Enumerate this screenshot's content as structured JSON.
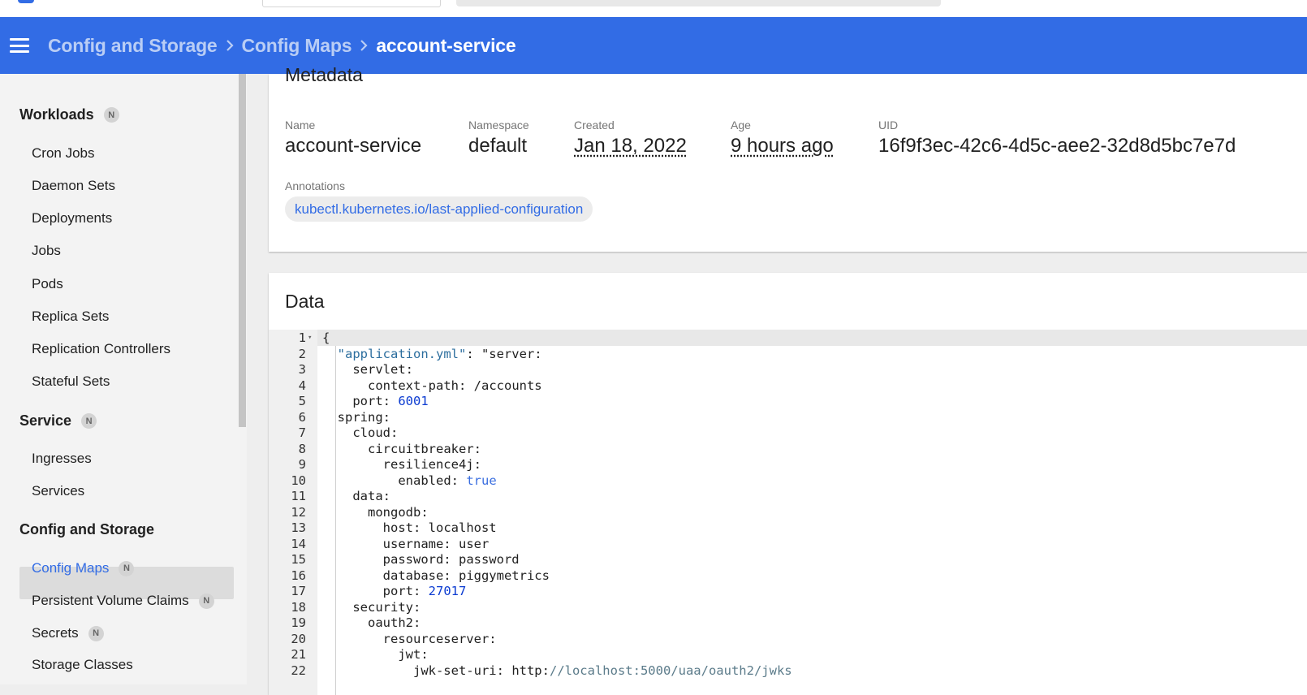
{
  "header": {
    "breadcrumbs": [
      "Config and Storage",
      "Config Maps",
      "account-service"
    ]
  },
  "sidebar": {
    "sections": [
      {
        "label": "Workloads",
        "badge": "N"
      },
      {
        "label": "Service",
        "badge": "N"
      },
      {
        "label": "Config and Storage"
      }
    ],
    "workloads_items": [
      "Cron Jobs",
      "Daemon Sets",
      "Deployments",
      "Jobs",
      "Pods",
      "Replica Sets",
      "Replication Controllers",
      "Stateful Sets"
    ],
    "service_items": [
      "Ingresses",
      "Services"
    ],
    "config_items": [
      {
        "label": "Config Maps",
        "badge": "N",
        "active": true
      },
      {
        "label": "Persistent Volume Claims",
        "badge": "N"
      },
      {
        "label": "Secrets",
        "badge": "N"
      },
      {
        "label": "Storage Classes"
      }
    ]
  },
  "metadata": {
    "title": "Metadata",
    "fields": {
      "name": {
        "label": "Name",
        "value": "account-service"
      },
      "namespace": {
        "label": "Namespace",
        "value": "default"
      },
      "created": {
        "label": "Created",
        "value": "Jan 18, 2022"
      },
      "age": {
        "label": "Age",
        "value": "9 hours ago"
      },
      "uid": {
        "label": "UID",
        "value": "16f9f3ec-42c6-4d5c-aee2-32d8d5bc7e7d"
      }
    },
    "annotations_label": "Annotations",
    "annotation_chip": "kubectl.kubernetes.io/last-applied-configuration"
  },
  "data_card": {
    "title": "Data",
    "lines": [
      "{",
      "  \"application.yml\": \"server:",
      "    servlet:",
      "      context-path: /accounts",
      "    port: 6001",
      "  spring:",
      "    cloud:",
      "      circuitbreaker:",
      "        resilience4j:",
      "          enabled: true",
      "    data:",
      "      mongodb:",
      "        host: localhost",
      "        username: user",
      "        password: password",
      "        database: piggymetrics",
      "        port: 27017",
      "    security:",
      "      oauth2:",
      "        resourceserver:",
      "          jwt:",
      "            jwk-set-uri: http://localhost:5000/uaa/oauth2/jwks"
    ]
  },
  "colors": {
    "accent": "#326ce5",
    "sidebar_bg": "#f3f3f3"
  }
}
